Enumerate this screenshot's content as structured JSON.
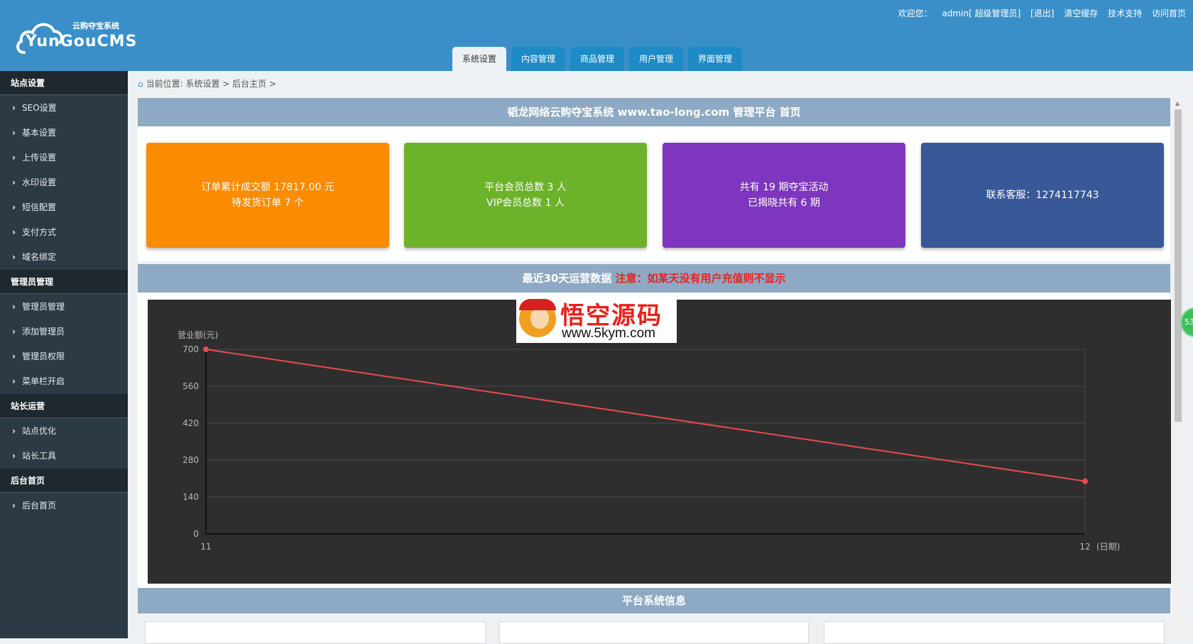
{
  "header": {
    "logo_subtitle": "云购夺宝系统",
    "logo_title": "YunGouCMS",
    "welcome": "欢迎您：",
    "user": "admin[ 超级管理员]",
    "links": [
      "[退出]",
      "清空缓存",
      "技术支持",
      "访问首页"
    ]
  },
  "tabs": [
    {
      "label": "系统设置",
      "active": true
    },
    {
      "label": "内容管理",
      "active": false
    },
    {
      "label": "商品管理",
      "active": false
    },
    {
      "label": "用户管理",
      "active": false
    },
    {
      "label": "界面管理",
      "active": false
    }
  ],
  "sidebar": {
    "groups": [
      {
        "title": "站点设置",
        "items": [
          "SEO设置",
          "基本设置",
          "上传设置",
          "水印设置",
          "短信配置",
          "支付方式",
          "域名绑定"
        ]
      },
      {
        "title": "管理员管理",
        "items": [
          "管理员管理",
          "添加管理员",
          "管理员权限",
          "菜单栏开启"
        ]
      },
      {
        "title": "站长运营",
        "items": [
          "站点优化",
          "站长工具"
        ]
      },
      {
        "title": "后台首页",
        "items": [
          "后台首页"
        ]
      }
    ]
  },
  "breadcrumb": {
    "prefix": "当前位置:",
    "path": "系统设置 > 后台主页 >"
  },
  "main": {
    "title": "韬龙网络云购夺宝系统 www.tao-long.com 管理平台 首页",
    "cards": [
      {
        "line1": "订单累计成交额 17817.00 元",
        "line2": "待发货订单 7 个",
        "color": "#fb8b00"
      },
      {
        "line1": "平台会员总数 3 人",
        "line2": "VIP会员总数 1 人",
        "color": "#6cb22a"
      },
      {
        "line1": "共有 19 期夺宝活动",
        "line2": "已揭晓共有 6 期",
        "color": "#7d36bd"
      },
      {
        "line1": "联系客服：1274117743",
        "line2": "",
        "color": "#395897"
      }
    ],
    "chart_section_title": "最近30天运营数据",
    "chart_note": "注意：如某天没有用户充值则不显示",
    "system_info_title": "平台系统信息"
  },
  "watermark": {
    "title": "悟空源码",
    "url": "www.5kym.com"
  },
  "badge": "53",
  "chart_data": {
    "type": "line",
    "ylabel": "营业额(元)",
    "xlabel": "(日期)",
    "x": [
      "11",
      "12"
    ],
    "series": [
      {
        "values": [
          700,
          200
        ],
        "color": "#e84c4c"
      }
    ],
    "ylim": [
      0,
      700
    ],
    "yticks": [
      0,
      140,
      280,
      420,
      560,
      700
    ],
    "grid": true
  }
}
